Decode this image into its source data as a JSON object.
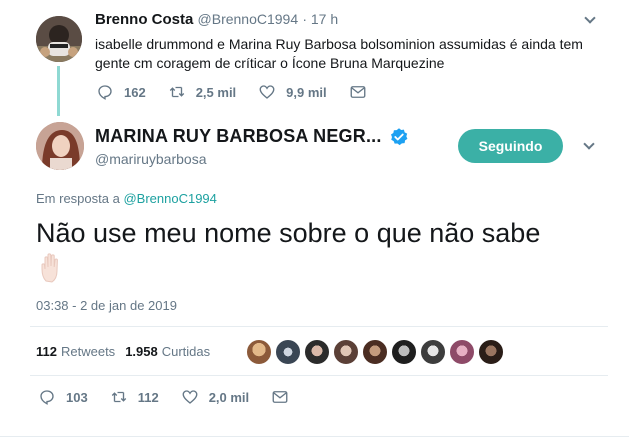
{
  "parent_tweet": {
    "name": "Brenno Costa",
    "handle": "@BrennoC1994",
    "time": "· 17 h",
    "text": "isabelle drummond e Marina Ruy Barbosa bolsominion assumidas é ainda tem gente cm coragem de críticar o Ícone Bruna Marquezine",
    "replies": "162",
    "retweets": "2,5 mil",
    "likes": "9,9 mil"
  },
  "main_tweet": {
    "name": "MARINA RUY BARBOSA NEGR...",
    "handle": "@mariruybarbosa",
    "follow_label": "Seguindo",
    "reply_prefix": "Em resposta a",
    "reply_target": "@BrennoC1994",
    "text": "Não use meu nome sobre o que não sabe",
    "emoji": "✋",
    "timestamp": "03:38 - 2 de jan de 2019",
    "stats": {
      "retweets_count": "112",
      "retweets_label": "Retweets",
      "likes_count": "1.958",
      "likes_label": "Curtidas"
    },
    "actions": {
      "replies": "103",
      "retweets": "112",
      "likes": "2,0 mil"
    }
  },
  "colors": {
    "accent": "#3bb0a6",
    "link": "#1da1a0",
    "thread_line": "#8fd9d3",
    "muted": "#657786",
    "verified": "#1da1f2"
  },
  "icons": [
    "reply-icon",
    "retweet-icon",
    "heart-icon",
    "mail-icon",
    "verified-icon",
    "chevron-down-icon",
    "raised-hand-icon"
  ]
}
